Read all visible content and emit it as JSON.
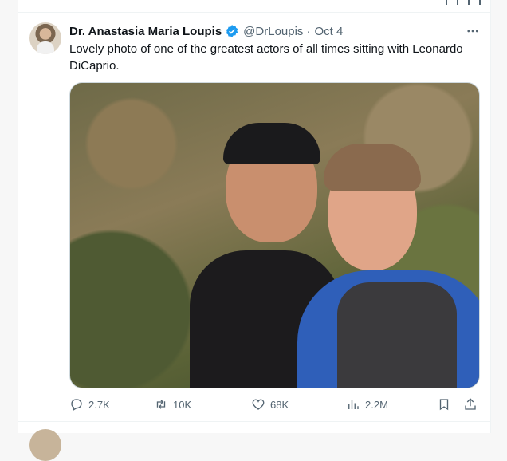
{
  "tweet": {
    "author_name": "Dr. Anastasia Maria Loupis",
    "handle": "@DrLoupis",
    "separator": "·",
    "date": "Oct 4",
    "text": "Lovely photo of one of the greatest actors of all times sitting with Leonardo DiCaprio."
  },
  "stats": {
    "replies": "2.7K",
    "retweets": "10K",
    "likes": "68K",
    "views": "2.2M"
  },
  "icons": {
    "verified": "verified-badge-icon",
    "more": "more-horizontal-icon",
    "reply": "reply-icon",
    "retweet": "retweet-icon",
    "like": "heart-icon",
    "views": "analytics-icon",
    "bookmark": "bookmark-icon",
    "share": "share-icon"
  },
  "colors": {
    "text_primary": "#0f1419",
    "text_secondary": "#536471",
    "verified_blue": "#1d9bf0",
    "border": "#eff3f4"
  }
}
